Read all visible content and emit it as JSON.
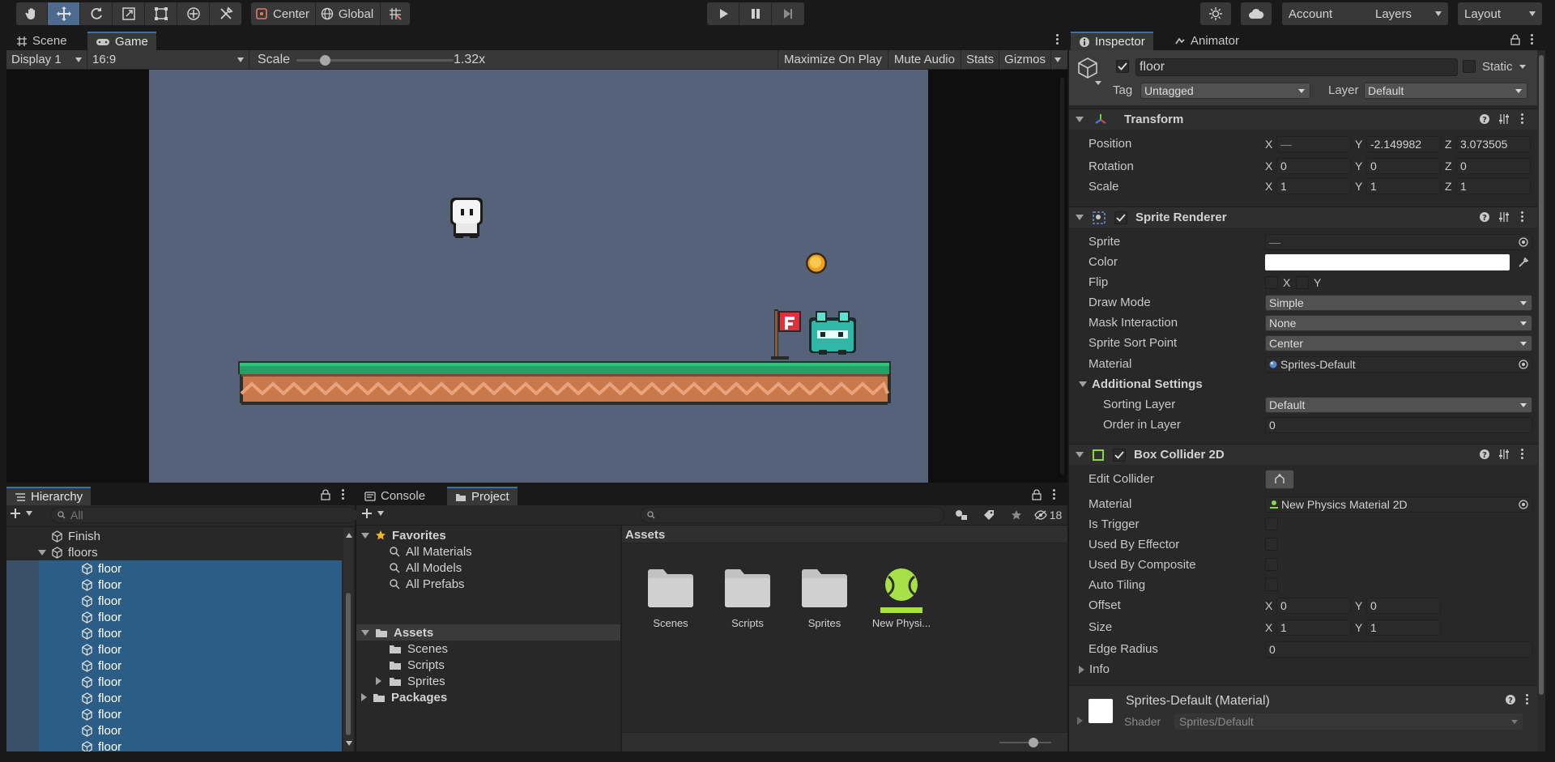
{
  "toolbar": {
    "tools": [
      "hand-tool",
      "move-tool",
      "rotate-tool",
      "scale-tool",
      "rect-tool",
      "transform-tool",
      "custom-tool"
    ],
    "pivot_label": "Center",
    "space_label": "Global",
    "account_label": "Account",
    "layers_label": "Layers",
    "layout_label": "Layout"
  },
  "scene_tabs": {
    "scene": "Scene",
    "game": "Game"
  },
  "game_bar": {
    "display": "Display 1",
    "aspect": "16:9",
    "scale_label": "Scale",
    "scale_value": "1.32x",
    "scale_fraction": 0.18,
    "maximize": "Maximize On Play",
    "mute": "Mute Audio",
    "stats": "Stats",
    "gizmos": "Gizmos"
  },
  "game_view": {
    "background": "#56627a"
  },
  "hierarchy": {
    "tab": "Hierarchy",
    "search_placeholder": "All",
    "items": [
      {
        "label": "Finish",
        "indent": 1,
        "selected": false,
        "expander": false
      },
      {
        "label": "floors",
        "indent": 1,
        "selected": false,
        "expander": true
      },
      {
        "label": "floor",
        "indent": 2,
        "selected": true
      },
      {
        "label": "floor",
        "indent": 2,
        "selected": true
      },
      {
        "label": "floor",
        "indent": 2,
        "selected": true
      },
      {
        "label": "floor",
        "indent": 2,
        "selected": true
      },
      {
        "label": "floor",
        "indent": 2,
        "selected": true
      },
      {
        "label": "floor",
        "indent": 2,
        "selected": true
      },
      {
        "label": "floor",
        "indent": 2,
        "selected": true
      },
      {
        "label": "floor",
        "indent": 2,
        "selected": true
      },
      {
        "label": "floor",
        "indent": 2,
        "selected": true
      },
      {
        "label": "floor",
        "indent": 2,
        "selected": true
      },
      {
        "label": "floor",
        "indent": 2,
        "selected": true
      },
      {
        "label": "floor",
        "indent": 2,
        "selected": true
      }
    ]
  },
  "project": {
    "console_tab": "Console",
    "project_tab": "Project",
    "hidden_count": "18",
    "favorites_label": "Favorites",
    "favorites": [
      "All Materials",
      "All Models",
      "All Prefabs"
    ],
    "assets_label": "Assets",
    "asset_folders": [
      "Scenes",
      "Scripts",
      "Sprites"
    ],
    "packages_label": "Packages",
    "breadcrumb": "Assets",
    "grid_items": [
      {
        "label": "Scenes",
        "icon": "folder-icon"
      },
      {
        "label": "Scripts",
        "icon": "folder-icon"
      },
      {
        "label": "Sprites",
        "icon": "folder-icon"
      },
      {
        "label": "New Physi...",
        "icon": "physics-material-icon"
      }
    ]
  },
  "inspector": {
    "inspector_tab": "Inspector",
    "animator_tab": "Animator",
    "object_name": "floor",
    "static_label": "Static",
    "tag_label": "Tag",
    "tag_value": "Untagged",
    "layer_label": "Layer",
    "layer_value": "Default",
    "transform": {
      "title": "Transform",
      "position_label": "Position",
      "rotation_label": "Rotation",
      "scale_label": "Scale",
      "position": {
        "x": "—",
        "y": "-2.149982",
        "z": "3.073505"
      },
      "rotation": {
        "x": "0",
        "y": "0",
        "z": "0"
      },
      "scale": {
        "x": "1",
        "y": "1",
        "z": "1"
      }
    },
    "sprite_renderer": {
      "title": "Sprite Renderer",
      "sprite_label": "Sprite",
      "sprite_value": "—",
      "color_label": "Color",
      "color_value": "#ffffff",
      "flip_label": "Flip",
      "draw_mode_label": "Draw Mode",
      "draw_mode_value": "Simple",
      "mask_label": "Mask Interaction",
      "mask_value": "None",
      "sort_point_label": "Sprite Sort Point",
      "sort_point_value": "Center",
      "material_label": "Material",
      "material_value": "Sprites-Default",
      "additional_label": "Additional Settings",
      "sorting_layer_label": "Sorting Layer",
      "sorting_layer_value": "Default",
      "order_label": "Order in Layer",
      "order_value": "0"
    },
    "box_collider": {
      "title": "Box Collider 2D",
      "edit_label": "Edit Collider",
      "material_label": "Material",
      "material_value": "New Physics Material 2D",
      "trigger_label": "Is Trigger",
      "effector_label": "Used By Effector",
      "composite_label": "Used By Composite",
      "tiling_label": "Auto Tiling",
      "offset_label": "Offset",
      "offset": {
        "x": "0",
        "y": "0"
      },
      "size_label": "Size",
      "size": {
        "x": "1",
        "y": "1"
      },
      "edge_label": "Edge Radius",
      "edge_value": "0",
      "info_label": "Info"
    },
    "material_preview": {
      "title": "Sprites-Default (Material)",
      "shader_label": "Shader",
      "shader_value": "Sprites/Default"
    },
    "axis_labels": {
      "x": "X",
      "y": "Y",
      "z": "Z"
    }
  }
}
